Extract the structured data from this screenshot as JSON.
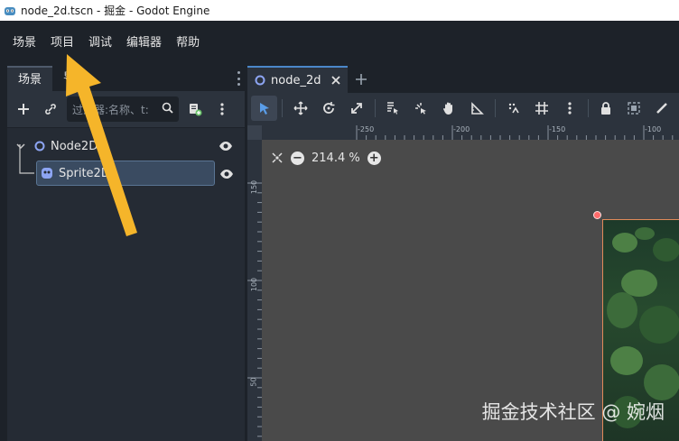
{
  "window": {
    "title": "node_2d.tscn - 掘金 - Godot Engine"
  },
  "menu": {
    "items": [
      "场景",
      "项目",
      "调试",
      "编辑器",
      "帮助"
    ]
  },
  "scene_dock": {
    "tabs": [
      "场景",
      "导"
    ],
    "filter_placeholder": "过滤器:名称、t:",
    "tree": {
      "root": {
        "label": "Node2D"
      },
      "child": {
        "label": "Sprite2D"
      }
    }
  },
  "editor": {
    "tab_label": "node_2d",
    "zoom_text": "214.4 %",
    "ruler_top": [
      "-250",
      "-200",
      "-150",
      "-100"
    ],
    "ruler_left": [
      "150",
      "100",
      "50"
    ]
  },
  "watermark": "掘金技术社区 @ 婉烟",
  "colors": {
    "accent": "#4b87c9",
    "arrow": "#f5b52a",
    "selection": "#3a4b61",
    "sprite_border": "#e08a5a"
  }
}
